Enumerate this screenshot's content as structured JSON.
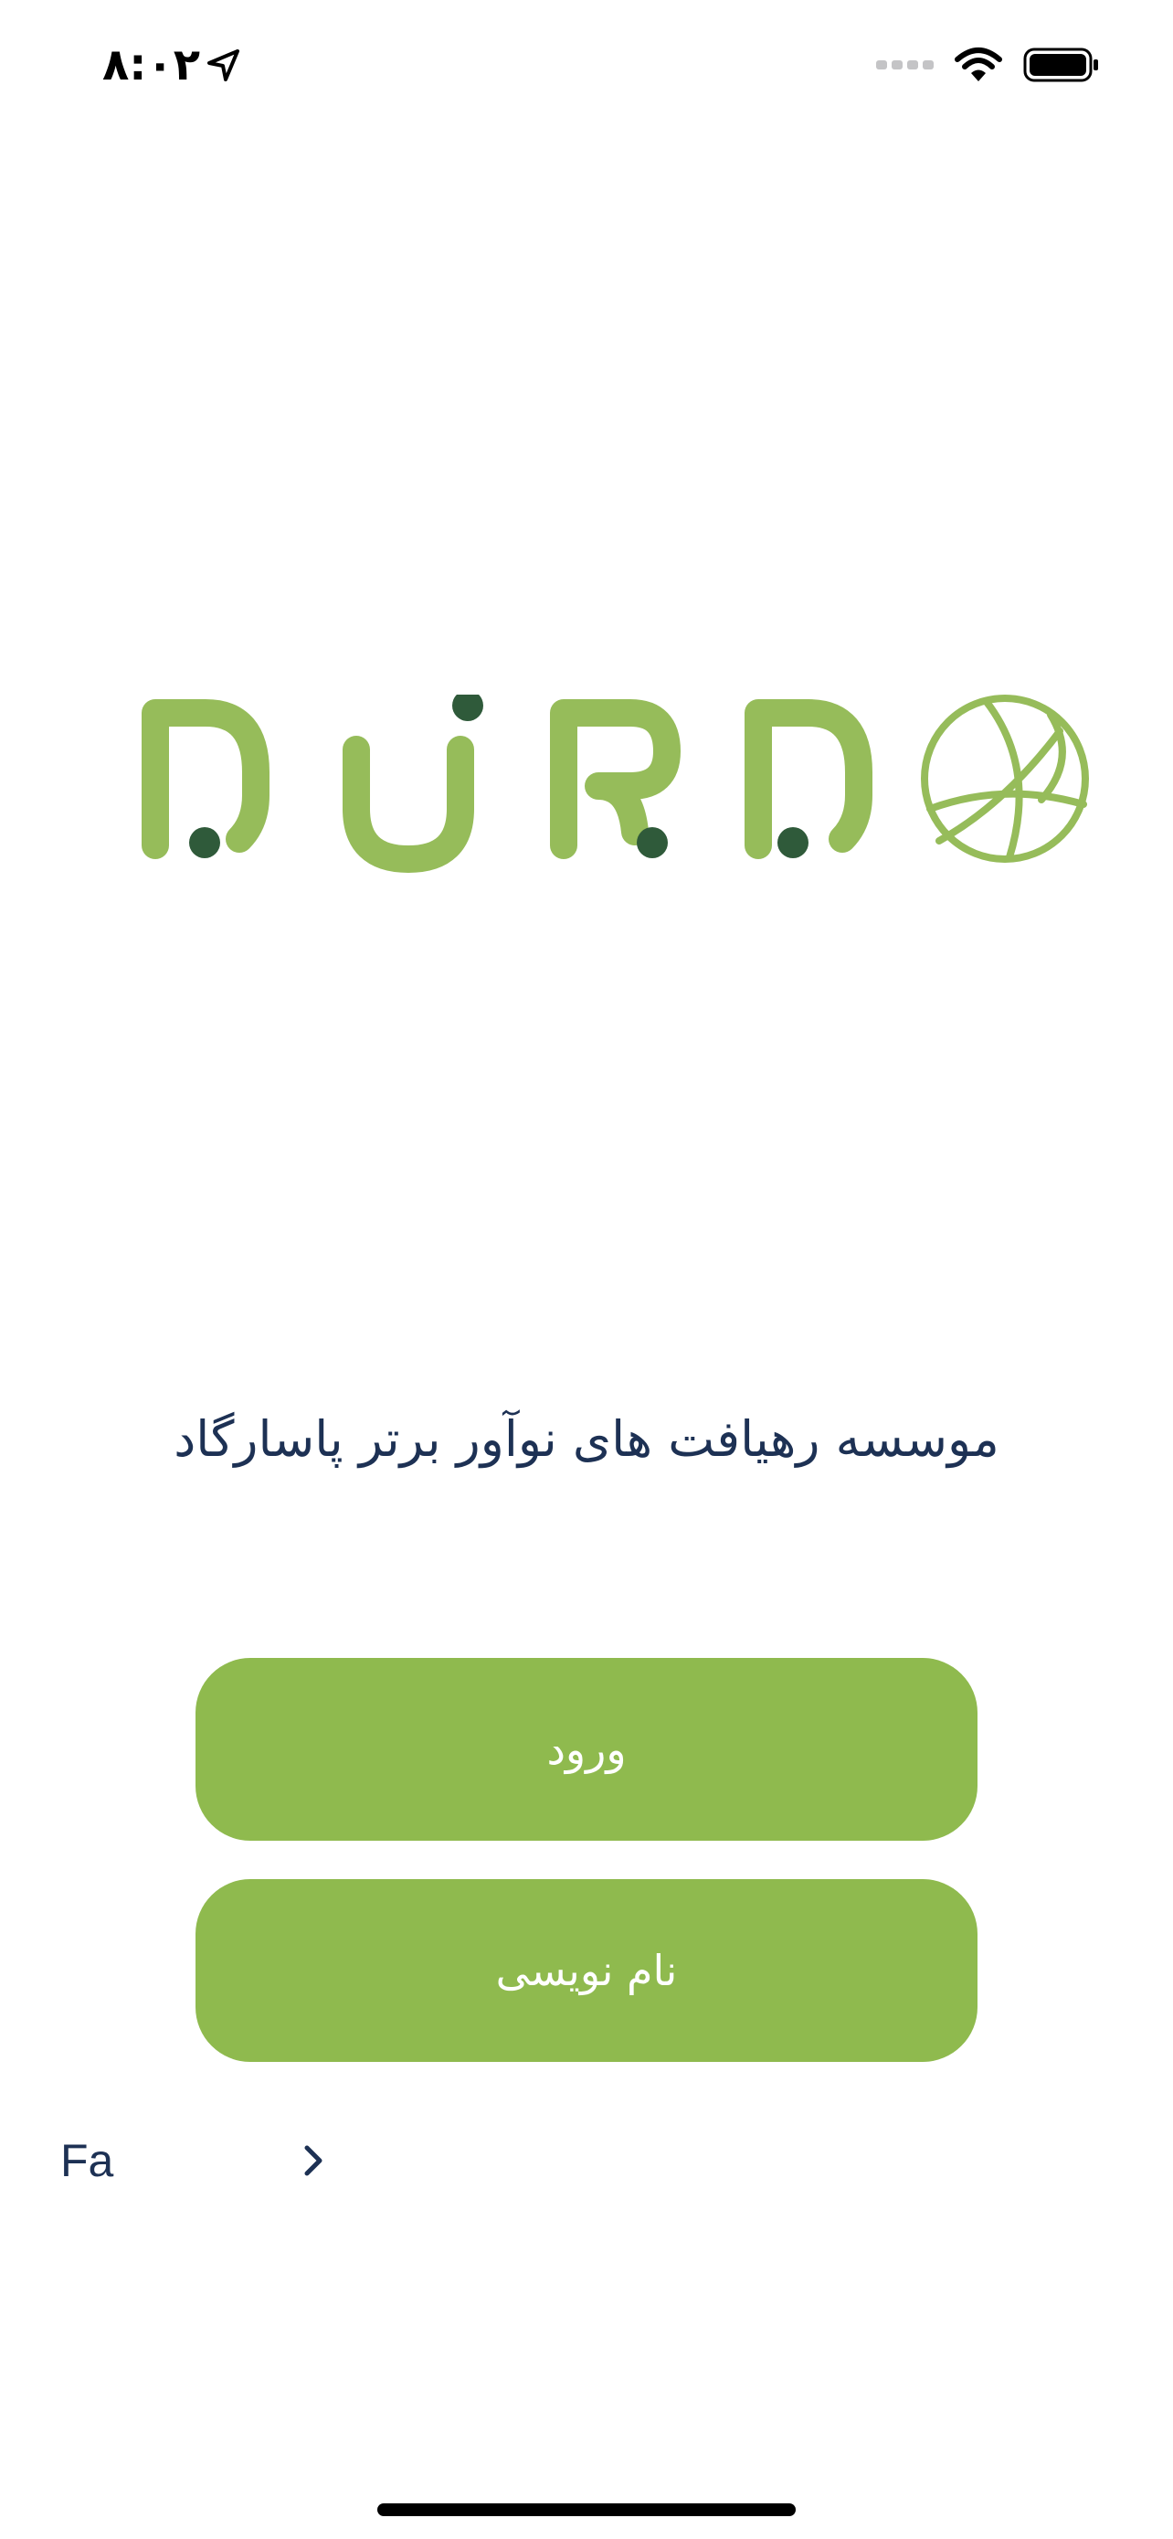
{
  "status_bar": {
    "time": "۸:۰۲",
    "location_icon": "location-arrow-icon",
    "signal_icon": "cellular-signal-icon",
    "wifi_icon": "wifi-icon",
    "battery_icon": "battery-icon"
  },
  "logo": {
    "text": "DURDO",
    "icon": "basketball-icon",
    "colors": {
      "letters": "#96bc5a",
      "dots": "#2f5a3a"
    }
  },
  "tagline": "موسسه رهیافت های نوآور برتر پاسارگاد",
  "buttons": {
    "login": "ورود",
    "signup": "نام نویسی"
  },
  "language": {
    "label": "Fa",
    "icon": "chevron-right-icon"
  },
  "colors": {
    "primary": "#8fba4e",
    "text": "#1d3154",
    "background": "#ffffff"
  }
}
